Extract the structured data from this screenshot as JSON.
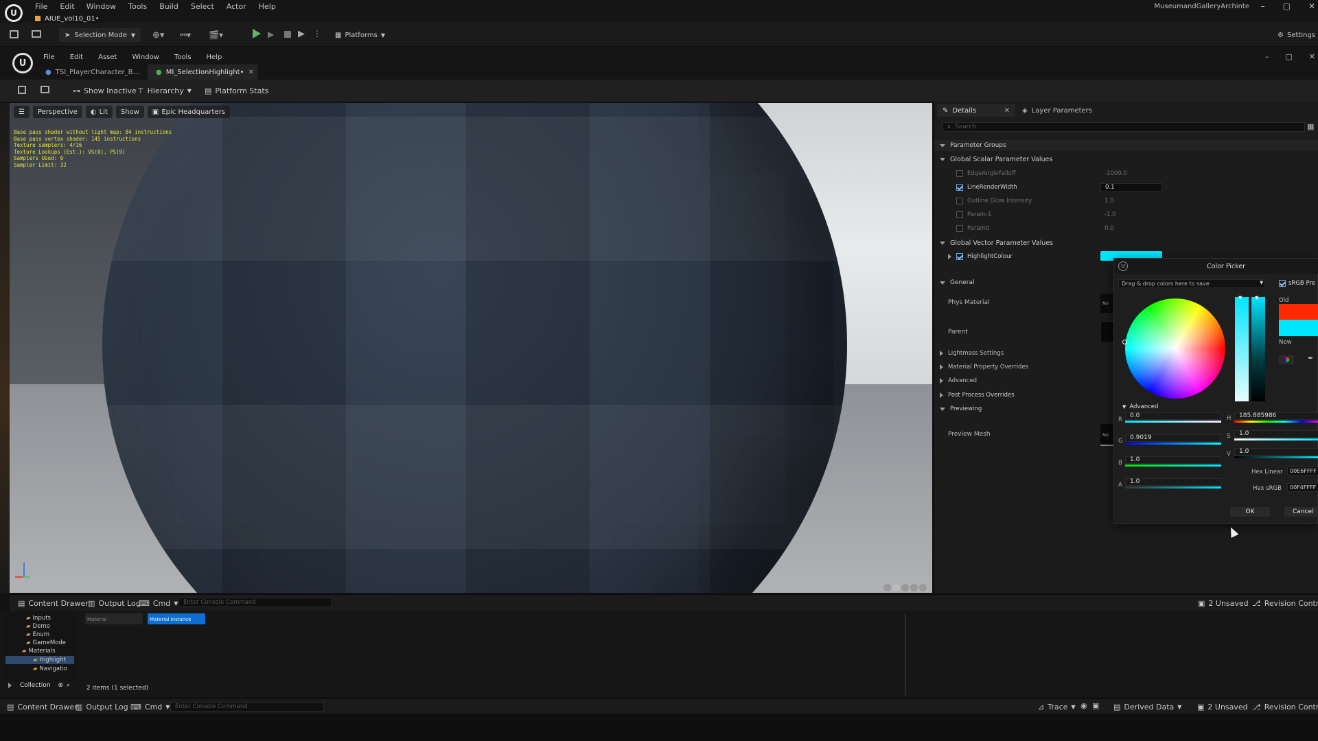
{
  "app": {
    "menu": [
      "File",
      "Edit",
      "Window",
      "Tools",
      "Build",
      "Select",
      "Actor",
      "Help"
    ],
    "level_tab": "AIUE_vol10_01•",
    "project_name": "MuseumandGalleryArchinte"
  },
  "main_toolbar": {
    "selection_mode": "Selection Mode",
    "platforms": "Platforms",
    "settings": "Settings"
  },
  "editor": {
    "menu": [
      "File",
      "Edit",
      "Asset",
      "Window",
      "Tools",
      "Help"
    ],
    "tabs": [
      {
        "label": "TSI_PlayerCharacter_B..."
      },
      {
        "label": "MI_SelectionHighlight•"
      }
    ],
    "toolbar": {
      "show_inactive": "Show Inactive",
      "hierarchy": "Hierarchy",
      "platform_stats": "Platform Stats"
    }
  },
  "viewport": {
    "perspective": "Perspective",
    "lit": "Lit",
    "show": "Show",
    "headquarters": "Epic Headquarters",
    "stats": [
      "Base pass shader without light map: 84 instructions",
      "Base pass vertex shader: 145 instructions",
      "Texture samplers: 4/16",
      "Texture Lookups (Est.): VS(0), PS(9)",
      "Samplers Used: 0",
      "Sampler Limit: 32"
    ]
  },
  "details": {
    "tab_details": "Details",
    "tab_layer_params": "Layer Parameters",
    "search_placeholder": "Search",
    "parameter_groups": "Parameter Groups",
    "scalar_header": "Global Scalar Parameter Values",
    "scalar_params": [
      {
        "name": "EdgeAngleFalloff",
        "value": "-1000.0",
        "checked": false
      },
      {
        "name": "LineRenderWidth",
        "value": "0.1",
        "checked": true
      },
      {
        "name": "Outline Glow Intensity",
        "value": "1.0",
        "checked": false
      },
      {
        "name": "Param-1",
        "value": "-1.0",
        "checked": false
      },
      {
        "name": "Param0",
        "value": "0.0",
        "checked": false
      }
    ],
    "vector_header": "Global Vector Parameter Values",
    "vector_param": {
      "name": "HighlightColour",
      "color": "#00EFFF"
    },
    "general": "General",
    "phys_material": "Phys Material",
    "parent": "Parent",
    "lightmass": "Lightmass Settings",
    "mat_overrides": "Material Property Overrides",
    "advanced": "Advanced",
    "post_process": "Post Process Overrides",
    "previewing": "Previewing",
    "preview_mesh": "Preview Mesh",
    "none_abbrev": "No"
  },
  "color_picker": {
    "title": "Color Picker",
    "dropdown": "Drag & drop colors here to save",
    "srgb": "sRGB Pre",
    "old_label": "Old",
    "new_label": "New",
    "old_color": "#FF2A00",
    "new_color": "#00E6FF",
    "advanced": "Advanced",
    "r_label": "R",
    "r": "0.0",
    "g_label": "G",
    "g": "0.9019",
    "b_label": "B",
    "b": "1.0",
    "a_label": "A",
    "a": "1.0",
    "h_label": "H",
    "h": "185.885986",
    "s_label": "S",
    "s": "1.0",
    "v_label": "V",
    "v": "1.0",
    "hex_linear_label": "Hex Linear",
    "hex_linear": "00E6FFFF",
    "hex_srgb_label": "Hex sRGB",
    "hex_srgb": "00F4FFFF",
    "ok": "OK",
    "cancel": "Cancel"
  },
  "drawer": {
    "content_drawer": "Content Drawer",
    "output_log": "Output Log",
    "cmd": "Cmd",
    "console_placeholder": "Enter Console Command",
    "unsaved": "2 Unsaved",
    "revision_control": "Revision Control",
    "folders": [
      "Inputs",
      "Demo",
      "Enum",
      "GameMode",
      "Materials",
      "Highlight",
      "Navigatio"
    ],
    "collection": "Collection",
    "assets": [
      "Material",
      "Material Instance"
    ],
    "items_count": "2 items (1 selected)"
  },
  "statusbar": {
    "content_drawer": "Content Drawer",
    "output_log": "Output Log",
    "cmd": "Cmd",
    "console_placeholder": "Enter Console Command",
    "trace": "Trace",
    "derived_data": "Derived Data",
    "unsaved": "2 Unsaved",
    "revision_control": "Revision Control"
  }
}
